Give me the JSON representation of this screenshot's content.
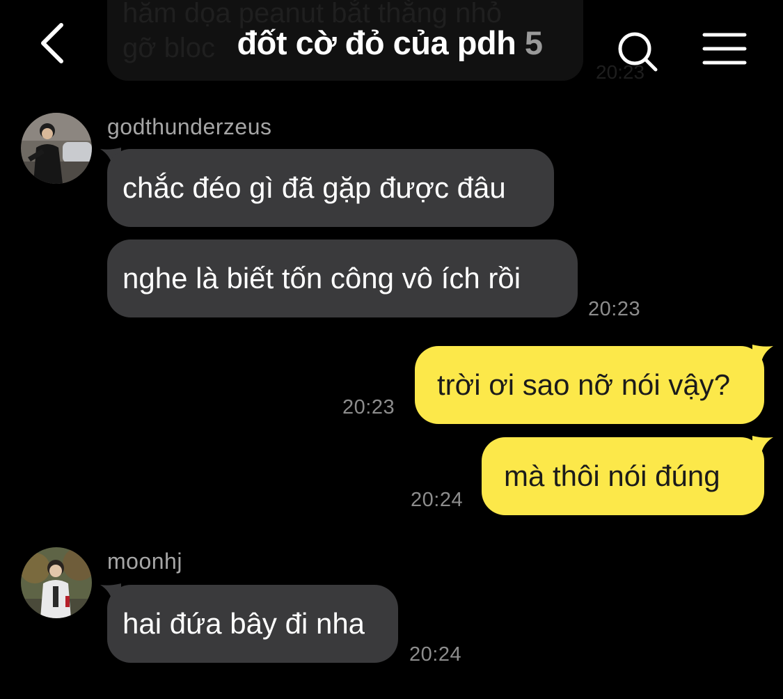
{
  "header": {
    "back_icon": "chevron-left-icon",
    "title": "đốt cờ đỏ của pdh",
    "member_count": "5",
    "search_icon": "search-icon",
    "menu_icon": "hamburger-menu-icon"
  },
  "ghost_message": {
    "line1": "hăm dọa peanut bắt thằng nhỏ",
    "line2": "gỡ bloc",
    "time": "20:23"
  },
  "messages": [
    {
      "sender": "godthunderzeus",
      "bubbles": [
        "chắc đéo gì đã gặp được đâu",
        "nghe là biết tốn công vô ích rồi"
      ],
      "time": "20:23"
    },
    {
      "sender": "me",
      "bubbles": [
        "trời ơi sao nỡ nói vậy?"
      ],
      "time": "20:23"
    },
    {
      "sender": "me",
      "bubbles": [
        "mà thôi nói đúng"
      ],
      "time": "20:24"
    },
    {
      "sender": "moonhj",
      "bubbles": [
        "hai đứa bây đi nha"
      ],
      "time": "20:24"
    }
  ],
  "colors": {
    "background": "#000000",
    "incoming_bubble": "#3a3a3c",
    "outgoing_bubble": "#fce84a",
    "timestamp": "#8d8d8d",
    "sender_name": "#a6a6a6"
  }
}
